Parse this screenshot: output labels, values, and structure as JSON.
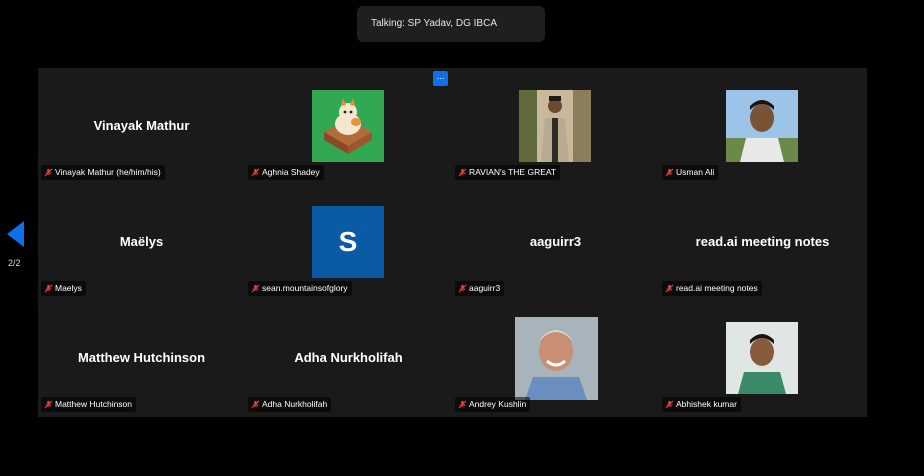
{
  "talking_label": "Talking: SP Yadav, DG IBCA",
  "more_button_label": "...",
  "page_indicator": "2/2",
  "accent_color": "#0e71eb",
  "participants": [
    {
      "display_name": "Vinayak Mathur",
      "tag": "Vinayak Mathur (he/him/his)",
      "muted": true
    },
    {
      "display_name": "",
      "tag": "Aghnia Shadey",
      "muted": true,
      "avatar": "cat-in-box-image"
    },
    {
      "display_name": "",
      "tag": "RAVIAN's THE GREAT",
      "muted": true,
      "avatar": "man-photo"
    },
    {
      "display_name": "",
      "tag": "Usman Ali",
      "muted": true,
      "avatar": "man-photo"
    },
    {
      "display_name": "Maëlys",
      "tag": "Maelys",
      "muted": true
    },
    {
      "display_name": "",
      "tag": "sean.mountainsofglory",
      "muted": true,
      "avatar_letter": "S"
    },
    {
      "display_name": "aaguirr3",
      "tag": "aaguirr3",
      "muted": true
    },
    {
      "display_name": "read.ai meeting notes",
      "tag": "read.ai meeting notes",
      "muted": true
    },
    {
      "display_name": "Matthew Hutchinson",
      "tag": "Matthew Hutchinson",
      "muted": true
    },
    {
      "display_name": "Adha Nurkholifah",
      "tag": "Adha Nurkholifah",
      "muted": true
    },
    {
      "display_name": "",
      "tag": "Andrey Kushlin",
      "muted": true,
      "avatar": "man-photo"
    },
    {
      "display_name": "",
      "tag": "Abhishek kumar",
      "muted": true,
      "avatar": "man-photo"
    }
  ]
}
